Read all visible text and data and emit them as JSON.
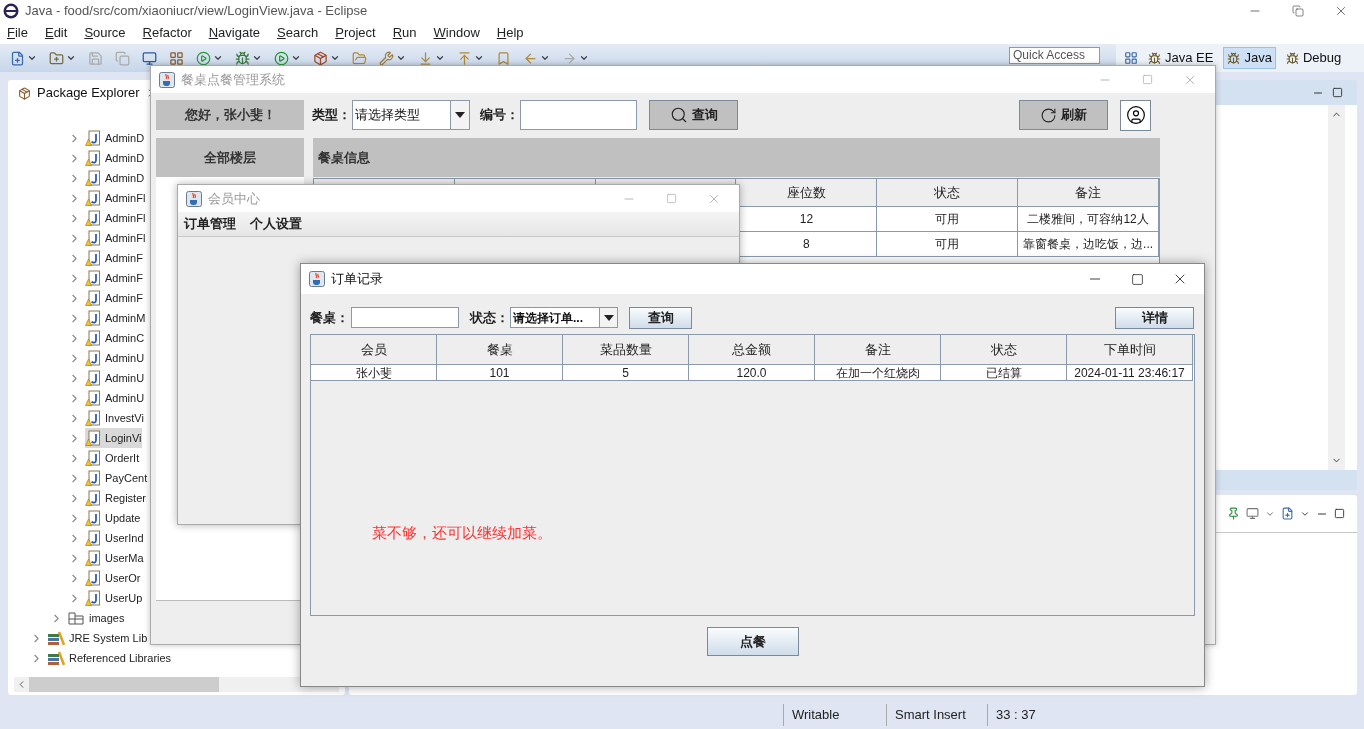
{
  "eclipse": {
    "title": "Java - food/src/com/xiaoniucr/view/LoginView.java - Eclipse",
    "menu": [
      "File",
      "Edit",
      "Source",
      "Refactor",
      "Navigate",
      "Search",
      "Project",
      "Run",
      "Window",
      "Help"
    ],
    "quick_access": "Quick Access",
    "perspectives": [
      {
        "label": "Java EE",
        "selected": false
      },
      {
        "label": "Java",
        "selected": true
      },
      {
        "label": "Debug",
        "selected": false
      }
    ],
    "package_explorer": {
      "title": "Package Explorer",
      "items": [
        {
          "label": "AdminD",
          "kind": "java",
          "selected": false
        },
        {
          "label": "AdminD",
          "kind": "java",
          "selected": false
        },
        {
          "label": "AdminD",
          "kind": "java",
          "selected": false
        },
        {
          "label": "AdminFl",
          "kind": "java",
          "selected": false
        },
        {
          "label": "AdminFl",
          "kind": "java",
          "selected": false
        },
        {
          "label": "AdminFl",
          "kind": "java",
          "selected": false
        },
        {
          "label": "AdminF",
          "kind": "java",
          "selected": false
        },
        {
          "label": "AdminF",
          "kind": "java",
          "selected": false
        },
        {
          "label": "AdminF",
          "kind": "java",
          "selected": false
        },
        {
          "label": "AdminM",
          "kind": "java",
          "selected": false
        },
        {
          "label": "AdminC",
          "kind": "java",
          "selected": false
        },
        {
          "label": "AdminU",
          "kind": "java",
          "selected": false
        },
        {
          "label": "AdminU",
          "kind": "java",
          "selected": false
        },
        {
          "label": "AdminU",
          "kind": "java",
          "selected": false
        },
        {
          "label": "InvestVi",
          "kind": "java",
          "selected": false
        },
        {
          "label": "LoginVi",
          "kind": "java",
          "selected": true
        },
        {
          "label": "OrderIt",
          "kind": "java",
          "selected": false
        },
        {
          "label": "PayCent",
          "kind": "java",
          "selected": false
        },
        {
          "label": "Register",
          "kind": "java",
          "selected": false
        },
        {
          "label": "Update",
          "kind": "java",
          "selected": false
        },
        {
          "label": "UserInd",
          "kind": "java",
          "selected": false
        },
        {
          "label": "UserMa",
          "kind": "java",
          "selected": false
        },
        {
          "label": "UserOr",
          "kind": "java",
          "selected": false
        },
        {
          "label": "UserUp",
          "kind": "java",
          "selected": false
        },
        {
          "label": "images",
          "kind": "folder",
          "selected": false
        },
        {
          "label": "JRE System Lib",
          "kind": "library",
          "selected": false
        },
        {
          "label": "Referenced Libraries",
          "kind": "library",
          "selected": false
        }
      ]
    },
    "status_bar": [
      "Writable",
      "Smart Insert",
      "33 : 37"
    ]
  },
  "main_window": {
    "title": "餐桌点餐管理系统",
    "active": false,
    "greeting": "您好，张小斐！",
    "type_label": "类型：",
    "type_value": "请选择类型",
    "number_label": "编号：",
    "search_button": "查询",
    "refresh_button": "刷新",
    "floor_header": "全部楼层",
    "table_title": "餐桌信息",
    "columns": [
      "座位数",
      "状态",
      "备注"
    ],
    "rows": [
      [
        "12",
        "可用",
        "二楼雅间，可容纳12人"
      ],
      [
        "8",
        "可用",
        "靠窗餐桌，边吃饭，边..."
      ]
    ]
  },
  "member_window": {
    "title": "会员中心",
    "active": false,
    "menu": [
      "订单管理",
      "个人设置"
    ]
  },
  "orders_window": {
    "title": "订单记录",
    "active": true,
    "table_label": "餐桌：",
    "status_label": "状态：",
    "status_value": "请选择订单...",
    "search_button": "查询",
    "details_button": "详情",
    "columns": [
      "会员",
      "餐桌",
      "菜品数量",
      "总金额",
      "备注",
      "状态",
      "下单时间"
    ],
    "rows": [
      [
        "张小斐",
        "101",
        "5",
        "120.0",
        "在加一个红烧肉",
        "已结算",
        "2024-01-11 23:46:17"
      ]
    ],
    "message": "菜不够，还可以继续加菜。",
    "order_button": "点餐"
  }
}
